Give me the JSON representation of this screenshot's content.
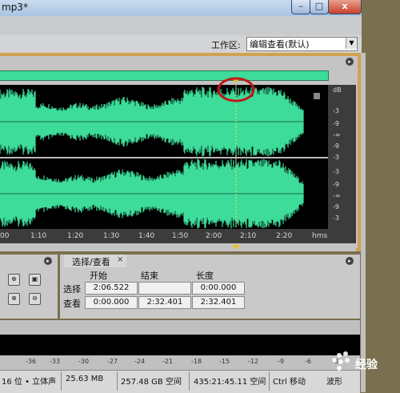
{
  "window": {
    "title": "mp3*",
    "min": "–",
    "max": "□",
    "close": "x"
  },
  "workspace": {
    "label": "工作区:",
    "value": "编辑查看(默认)",
    "arrow": "▼"
  },
  "panel_menu": "▸",
  "db_labels": [
    "dB",
    "-3",
    "-9",
    "-∞",
    "-9",
    "-3",
    "-3",
    "-9",
    "-∞",
    "-9",
    "-3"
  ],
  "timeline": [
    "00",
    "1:10",
    "1:20",
    "1:30",
    "1:40",
    "1:50",
    "2:00",
    "2:10",
    "2:20",
    "hms"
  ],
  "selection_panel": {
    "tab": "选择/查看",
    "close": "×",
    "headers": {
      "start": "开始",
      "end": "结束",
      "length": "长度"
    },
    "rows": [
      {
        "label": "选择",
        "start": "2:06.522",
        "end": "",
        "length": "0:00.000"
      },
      {
        "label": "查看",
        "start": "0:00.000",
        "end": "2:32.401",
        "length": "2:32.401"
      }
    ]
  },
  "meter_labels": [
    "-36",
    "-33",
    "-30",
    "-27",
    "-24",
    "-21",
    "-18",
    "-15",
    "-12",
    "-9",
    "-6",
    "-3"
  ],
  "status": {
    "format": "16 位 • 立体声",
    "file_size": "25.63 MB",
    "disk_free": "257.48 GB 空间",
    "time_free": "435:21:45.11 空间",
    "hint": "Ctrl 移动",
    "waveform": "波形"
  },
  "colors": {
    "waveform": "#3ddc9a",
    "panel_accent": "#d0a24f",
    "highlight_circle": "#c01818"
  }
}
